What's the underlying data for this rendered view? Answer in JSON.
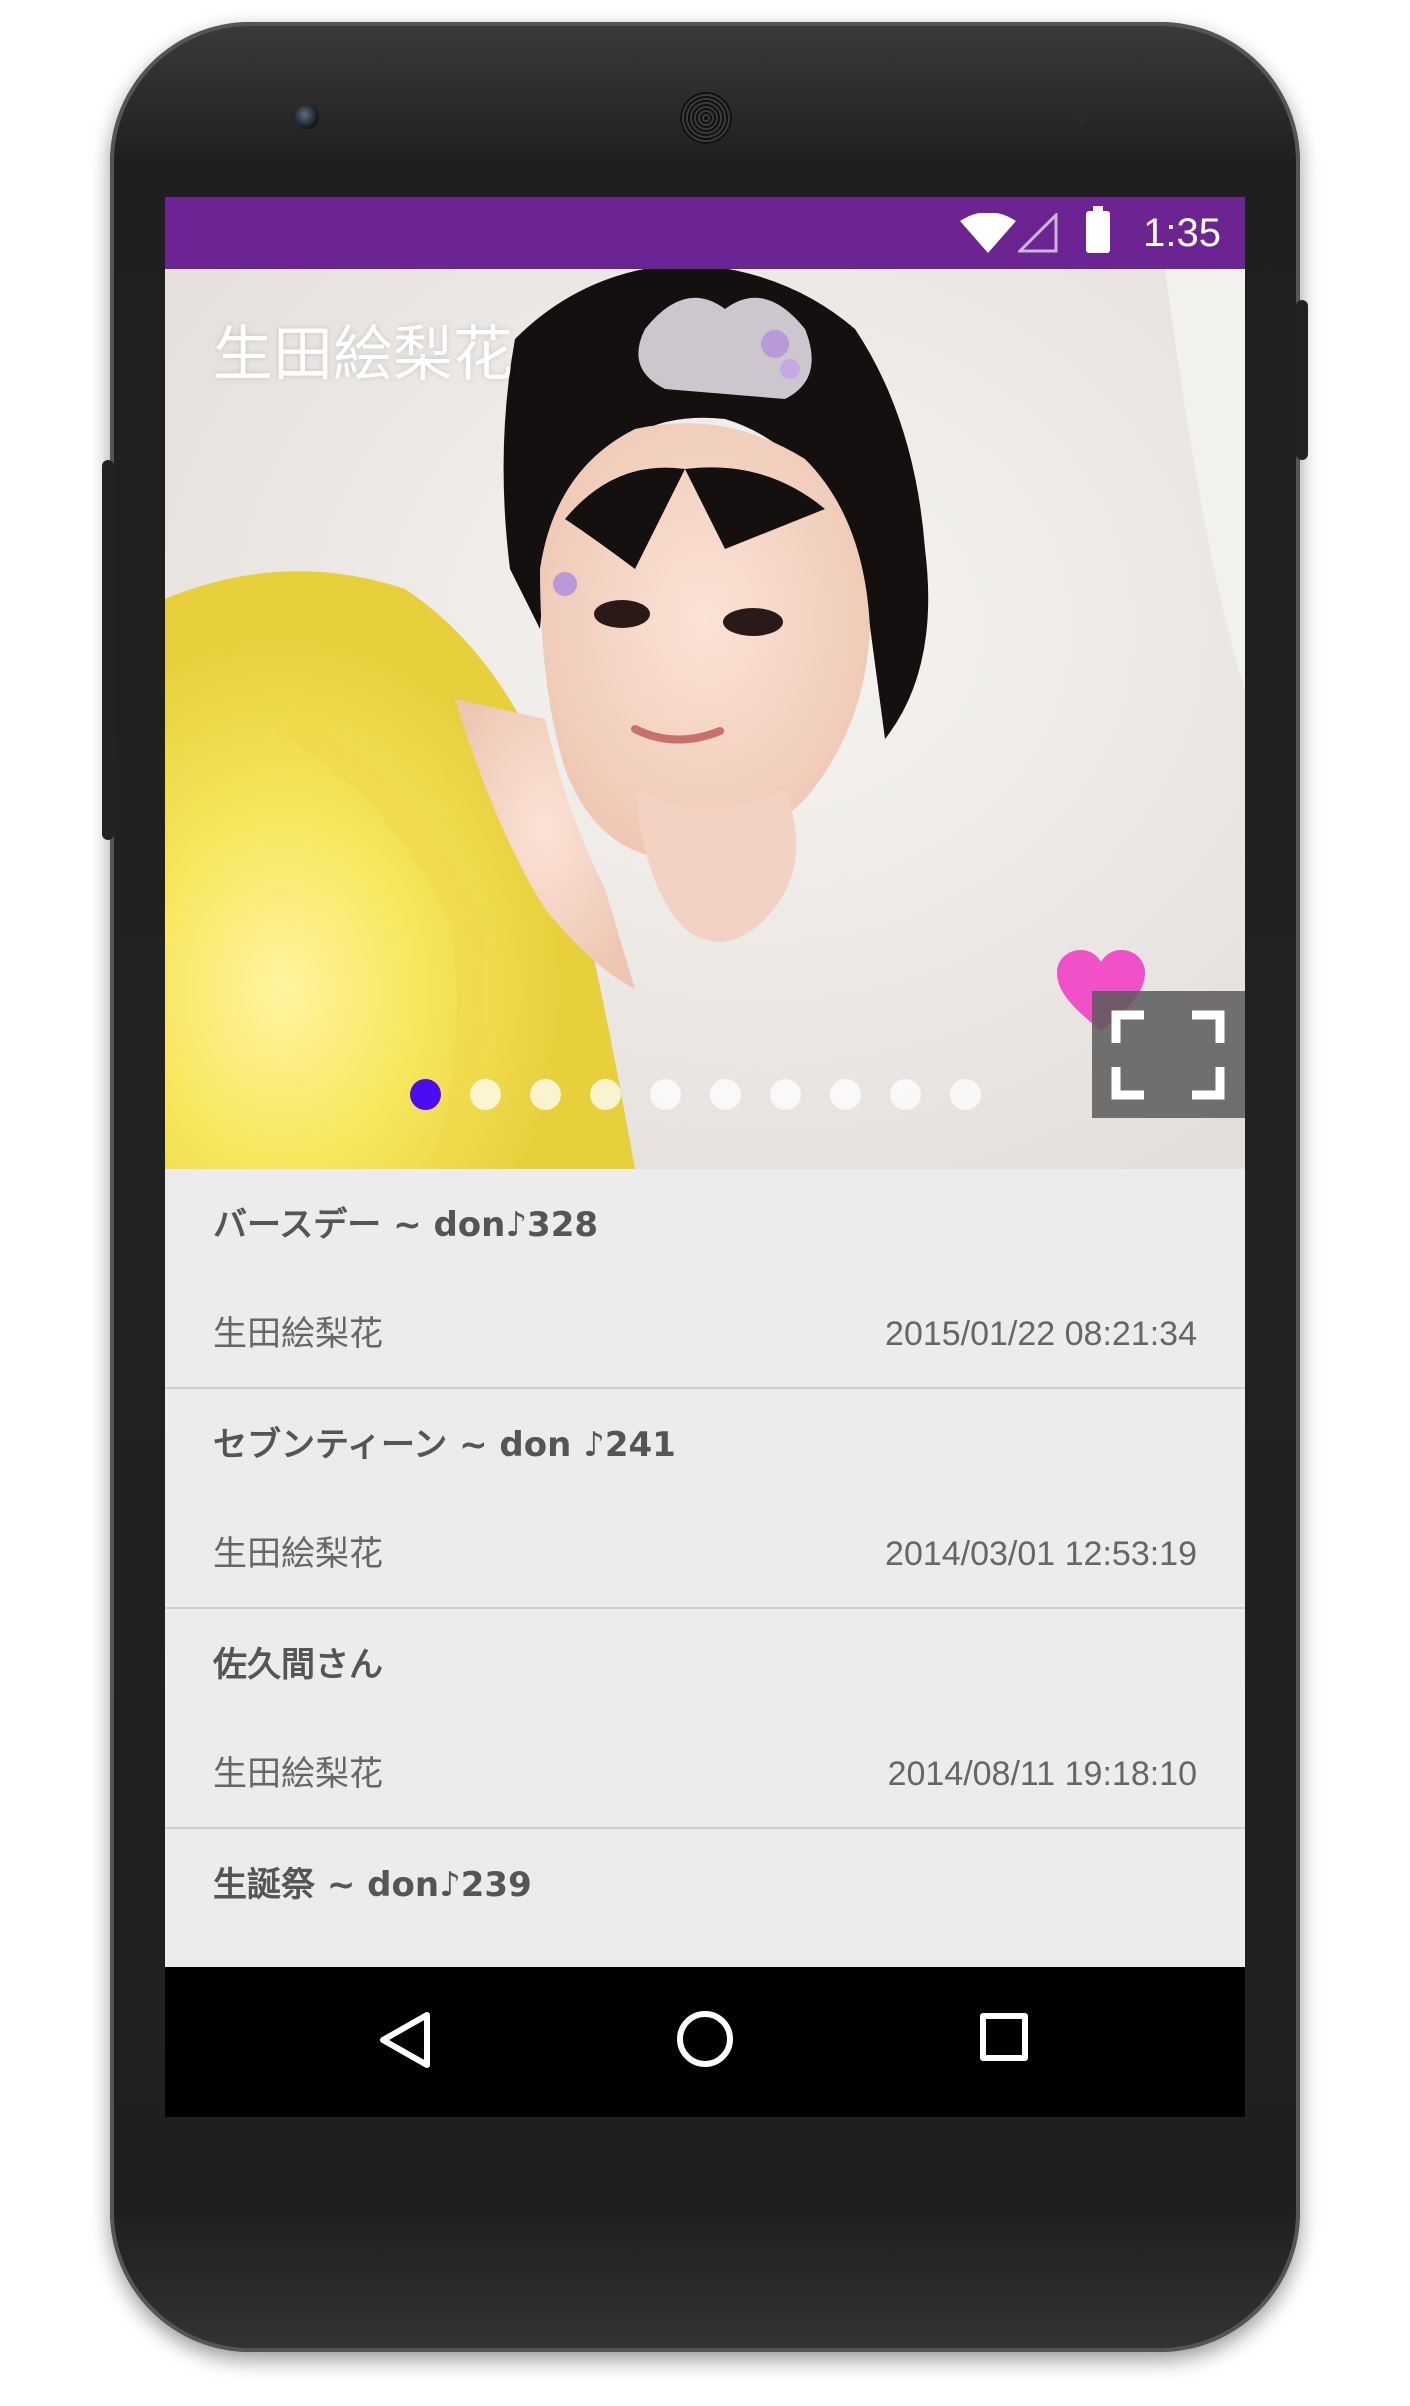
{
  "status_bar": {
    "time": "1:35",
    "color": "#6b2491"
  },
  "hero": {
    "title": "生田絵梨花",
    "page_count": 10,
    "active_page": 1,
    "dot_active_color": "#4a0cf2",
    "heart_color": "#f050c8"
  },
  "list": {
    "items": [
      {
        "title": "バースデー ~ don♪328",
        "author": "生田絵梨花",
        "date": "2015/01/22 08:21:34"
      },
      {
        "title": "セブンティーン ~ don ♪241",
        "author": "生田絵梨花",
        "date": "2014/03/01 12:53:19"
      },
      {
        "title": "佐久間さん",
        "author": "生田絵梨花",
        "date": "2014/08/11 19:18:10"
      },
      {
        "title": "生誕祭 ~ don♪239",
        "author": "",
        "date": ""
      }
    ]
  },
  "icons": {
    "wifi": "wifi-icon",
    "signal": "cell-signal-icon",
    "battery": "battery-icon",
    "favorite": "heart-icon",
    "fullscreen": "fullscreen-icon",
    "back": "back-triangle-icon",
    "home": "home-circle-icon",
    "recents": "recents-square-icon"
  }
}
